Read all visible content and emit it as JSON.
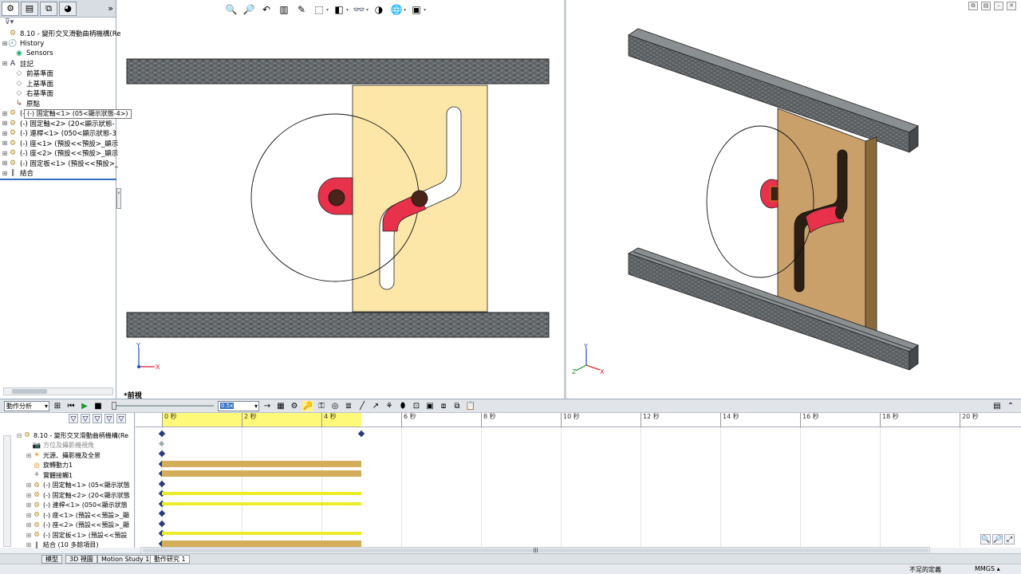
{
  "feature_manager": {
    "tabs": [
      "featuremanager-tab-icon",
      "property-tab-icon",
      "config-tab-icon",
      "display-tab-icon"
    ],
    "tree": [
      {
        "label": "8.10 - 變形交叉滑動曲柄機構(Rec",
        "icon": "assembly-icon",
        "pm": ""
      },
      {
        "label": "History",
        "icon": "history-icon",
        "pm": "+"
      },
      {
        "label": "Sensors",
        "icon": "sensor-icon",
        "pm": ""
      },
      {
        "label": "註記",
        "icon": "annotation-icon",
        "pm": "+"
      },
      {
        "label": "前基準面",
        "icon": "plane-icon",
        "pm": ""
      },
      {
        "label": "上基準面",
        "icon": "plane-icon",
        "pm": ""
      },
      {
        "label": "右基準面",
        "icon": "plane-icon",
        "pm": ""
      },
      {
        "label": "原點",
        "icon": "origin-icon",
        "pm": ""
      },
      {
        "label": "(-) 固定軸<1> (05<顯示狀態-4>)",
        "icon": "part-icon",
        "pm": "+"
      },
      {
        "label": "(-) 固定軸<2> (20<顯示狀態-",
        "icon": "part-icon",
        "pm": "+"
      },
      {
        "label": "(-) 連桿<1> (050<顯示狀態-3",
        "icon": "part-icon",
        "pm": "+"
      },
      {
        "label": "(-) 座<1> (預設<<預設>_顯示",
        "icon": "part-icon",
        "pm": "+"
      },
      {
        "label": "(-) 座<2> (預設<<預設>_顯示",
        "icon": "part-icon",
        "pm": "+"
      },
      {
        "label": "(-) 固定板<1> (預設<<預設>_",
        "icon": "part-icon",
        "pm": "+"
      },
      {
        "label": "結合",
        "icon": "mate-icon",
        "pm": "+"
      }
    ],
    "tooltip": "(-) 固定軸<1> (05<顯示狀態-4>)"
  },
  "viewport": {
    "view_name": "*前視",
    "heads_up_icons": [
      "zoom-fit-icon",
      "zoom-area-icon",
      "previous-view-icon",
      "section-view-icon",
      "dynamic-annotation-icon",
      "view-orientation-icon",
      "display-style-icon",
      "hide-show-icon",
      "edit-appearance-icon",
      "apply-scene-icon",
      "view-settings-icon"
    ],
    "axis_labels": {
      "x": "X",
      "y": "Y",
      "z": "Z"
    }
  },
  "motion_manager": {
    "study_type": "動作分析",
    "playback_speed": "0.5x",
    "tree": [
      {
        "label": "8.10 - 變形交叉滑動曲柄機構(Re",
        "icon": "assembly-icon",
        "pm": "−",
        "indent": 0,
        "gray": false
      },
      {
        "label": "方位及攝影機視角",
        "icon": "camera-icon",
        "pm": "",
        "indent": 1,
        "gray": true
      },
      {
        "label": "光源、攝影機及全景",
        "icon": "lights-icon",
        "pm": "+",
        "indent": 1,
        "gray": false
      },
      {
        "label": "旋轉動力1",
        "icon": "motor-icon",
        "pm": "",
        "indent": 1,
        "gray": false
      },
      {
        "label": "實體接觸1",
        "icon": "contact-icon",
        "pm": "",
        "indent": 1,
        "gray": false
      },
      {
        "label": "(-) 固定軸<1> (05<顯示狀態",
        "icon": "part-icon",
        "pm": "+",
        "indent": 1,
        "gray": false
      },
      {
        "label": "(-) 固定軸<2> (20<顯示狀態",
        "icon": "part-icon",
        "pm": "+",
        "indent": 1,
        "gray": false
      },
      {
        "label": "(-) 連桿<1> (050<顯示狀態",
        "icon": "part-icon",
        "pm": "+",
        "indent": 1,
        "gray": false
      },
      {
        "label": "(-) 座<1> (預設<<預設>_顯",
        "icon": "part-icon",
        "pm": "+",
        "indent": 1,
        "gray": false
      },
      {
        "label": "(-) 座<2> (預設<<預設>_顯",
        "icon": "part-icon",
        "pm": "+",
        "indent": 1,
        "gray": false
      },
      {
        "label": "(-) 固定板<1> (預設<<預設",
        "icon": "part-icon",
        "pm": "+",
        "indent": 1,
        "gray": false
      },
      {
        "label": "結合 (10 多餘項目)",
        "icon": "mate-icon",
        "pm": "+",
        "indent": 1,
        "gray": false
      }
    ],
    "ruler_ticks": [
      "0 秒",
      "2 秒",
      "4 秒",
      "6 秒",
      "8 秒",
      "10 秒",
      "12 秒",
      "14 秒",
      "16 秒",
      "18 秒",
      "20 秒"
    ],
    "timeline_end_seconds": 5,
    "bars": [
      {
        "row": 3,
        "style": "gold"
      },
      {
        "row": 4,
        "style": "gold"
      },
      {
        "row": 6,
        "style": "yellow"
      },
      {
        "row": 7,
        "style": "yellow"
      },
      {
        "row": 10,
        "style": "yellow"
      },
      {
        "row": 11,
        "style": "gold"
      }
    ]
  },
  "bottom_tabs": [
    "模型",
    "3D 視圖",
    "Motion Study 1",
    "動作研究 1"
  ],
  "active_tab": 3,
  "status": {
    "message": "不足的定義",
    "units": "MMGS"
  },
  "colors": {
    "plate": "#fce6a8",
    "plate_3d": "#c9a06a",
    "crank": "#e8314b",
    "brick": "#5a5f62"
  }
}
